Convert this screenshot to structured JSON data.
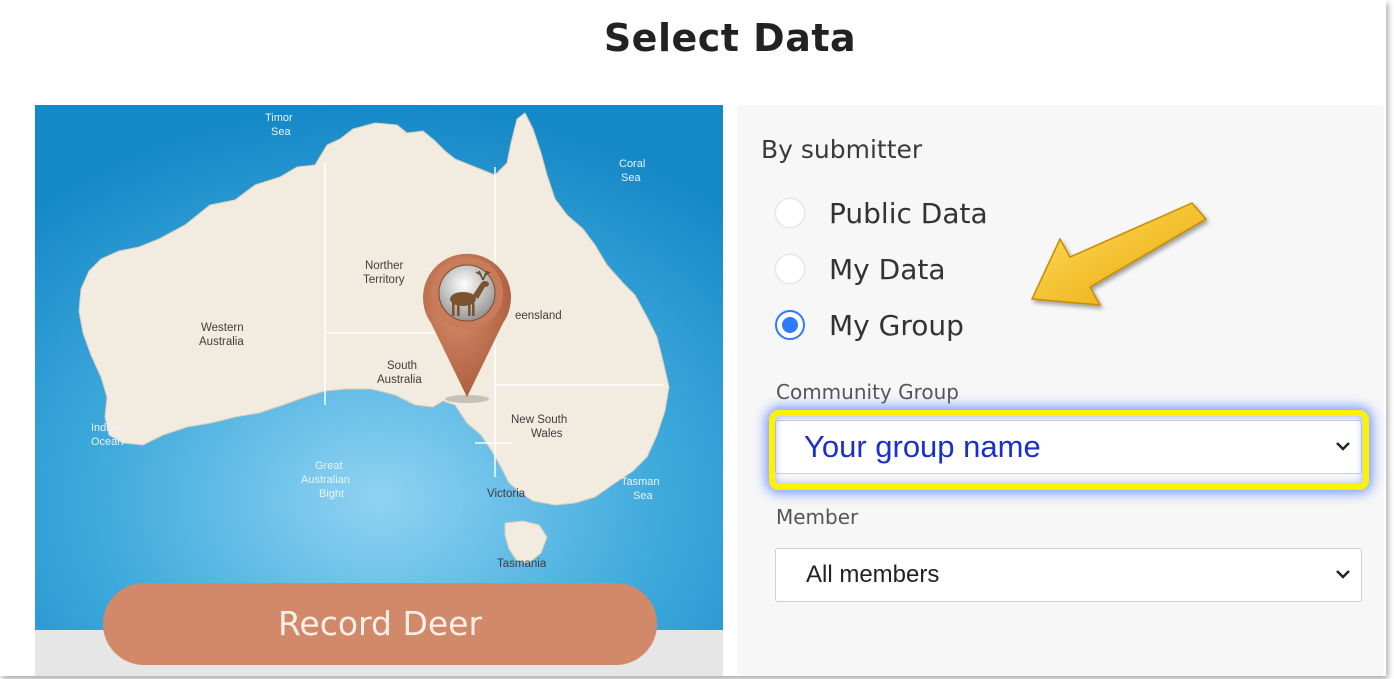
{
  "page": {
    "title": "Select Data"
  },
  "map": {
    "record_button": "Record Deer",
    "labels": {
      "timor_sea_1": "Timor",
      "timor_sea_2": "Sea",
      "coral_sea_1": "Coral",
      "coral_sea_2": "Sea",
      "northern_territory_1": "Norther",
      "northern_territory_2": "Territory",
      "queensland": "eensland",
      "western_australia_1": "Western",
      "western_australia_2": "Australia",
      "south_australia_1": "South",
      "south_australia_2": "Australia",
      "new_south_wales_1": "New South",
      "new_south_wales_2": "Wales",
      "indian_ocean_1": "Indian",
      "indian_ocean_2": "Ocean",
      "great_bight_1": "Great",
      "great_bight_2": "Australian",
      "great_bight_3": "Bight",
      "victoria": "Victoria",
      "tasman_sea_1": "Tasman",
      "tasman_sea_2": "Sea",
      "tasmania": "Tasmania"
    },
    "marker_icon": "deer-icon"
  },
  "filters": {
    "by_submitter_label": "By submitter",
    "options": [
      {
        "label": "Public Data",
        "checked": false
      },
      {
        "label": "My Data",
        "checked": false
      },
      {
        "label": "My Group",
        "checked": true
      }
    ],
    "community_group_label": "Community Group",
    "community_group_value": "Your group name",
    "member_label": "Member",
    "member_value": "All members"
  },
  "colors": {
    "accent_radio": "#2f7bff",
    "record_button": "#d2896a",
    "highlight": "#fff200",
    "arrow": "#f5b800"
  }
}
